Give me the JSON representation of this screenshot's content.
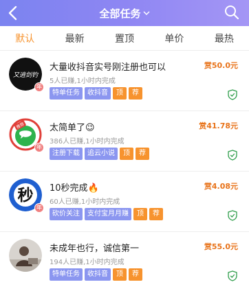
{
  "header": {
    "title": "全部任务",
    "back_icon": "chevron-left-icon",
    "search_icon": "search-icon",
    "gradient": [
      "#7b83f0",
      "#a496f5"
    ]
  },
  "tabs": [
    {
      "label": "默认",
      "active": true
    },
    {
      "label": "最新",
      "active": false
    },
    {
      "label": "置顶",
      "active": false
    },
    {
      "label": "单价",
      "active": false
    },
    {
      "label": "最热",
      "active": false
    }
  ],
  "tasks": [
    {
      "title": "大量收抖音实号刚注册也可以",
      "meta": "5人已赚,1小时内完成",
      "reward": "赏50.0元",
      "tags": [
        "特单任务",
        "收抖音"
      ],
      "flags": [
        "顶",
        "荐"
      ],
      "avatar_text": "又逍剑钓",
      "year_badge": "年"
    },
    {
      "title": "太简单了😉",
      "meta": "386人已赚,1小时内完成",
      "reward": "赏41.78元",
      "tags": [
        "注册下载",
        "追云小说"
      ],
      "flags": [
        "顶",
        "荐"
      ],
      "avatar_ribbon": "推荐",
      "year_badge": "年"
    },
    {
      "title": "10秒完成🔥",
      "meta": "60人已赚,1小时内完成",
      "reward": "赏4.08元",
      "tags": [
        "砍价关注",
        "支付宝月月赚"
      ],
      "flags": [
        "顶",
        "荐"
      ],
      "avatar_text": "秒",
      "year_badge": "年"
    },
    {
      "title": "未成年也行，诚信第一",
      "meta": "194人已赚,1小时内完成",
      "reward": "赏55.0元",
      "tags": [
        "特单任务",
        "收抖音"
      ],
      "flags": [
        "顶",
        "荐"
      ]
    }
  ],
  "colors": {
    "accent_orange": "#f7932e",
    "reward_orange": "#e8731a",
    "tag_purple": "#8b96f0",
    "shield_green": "#2e9d4a"
  }
}
